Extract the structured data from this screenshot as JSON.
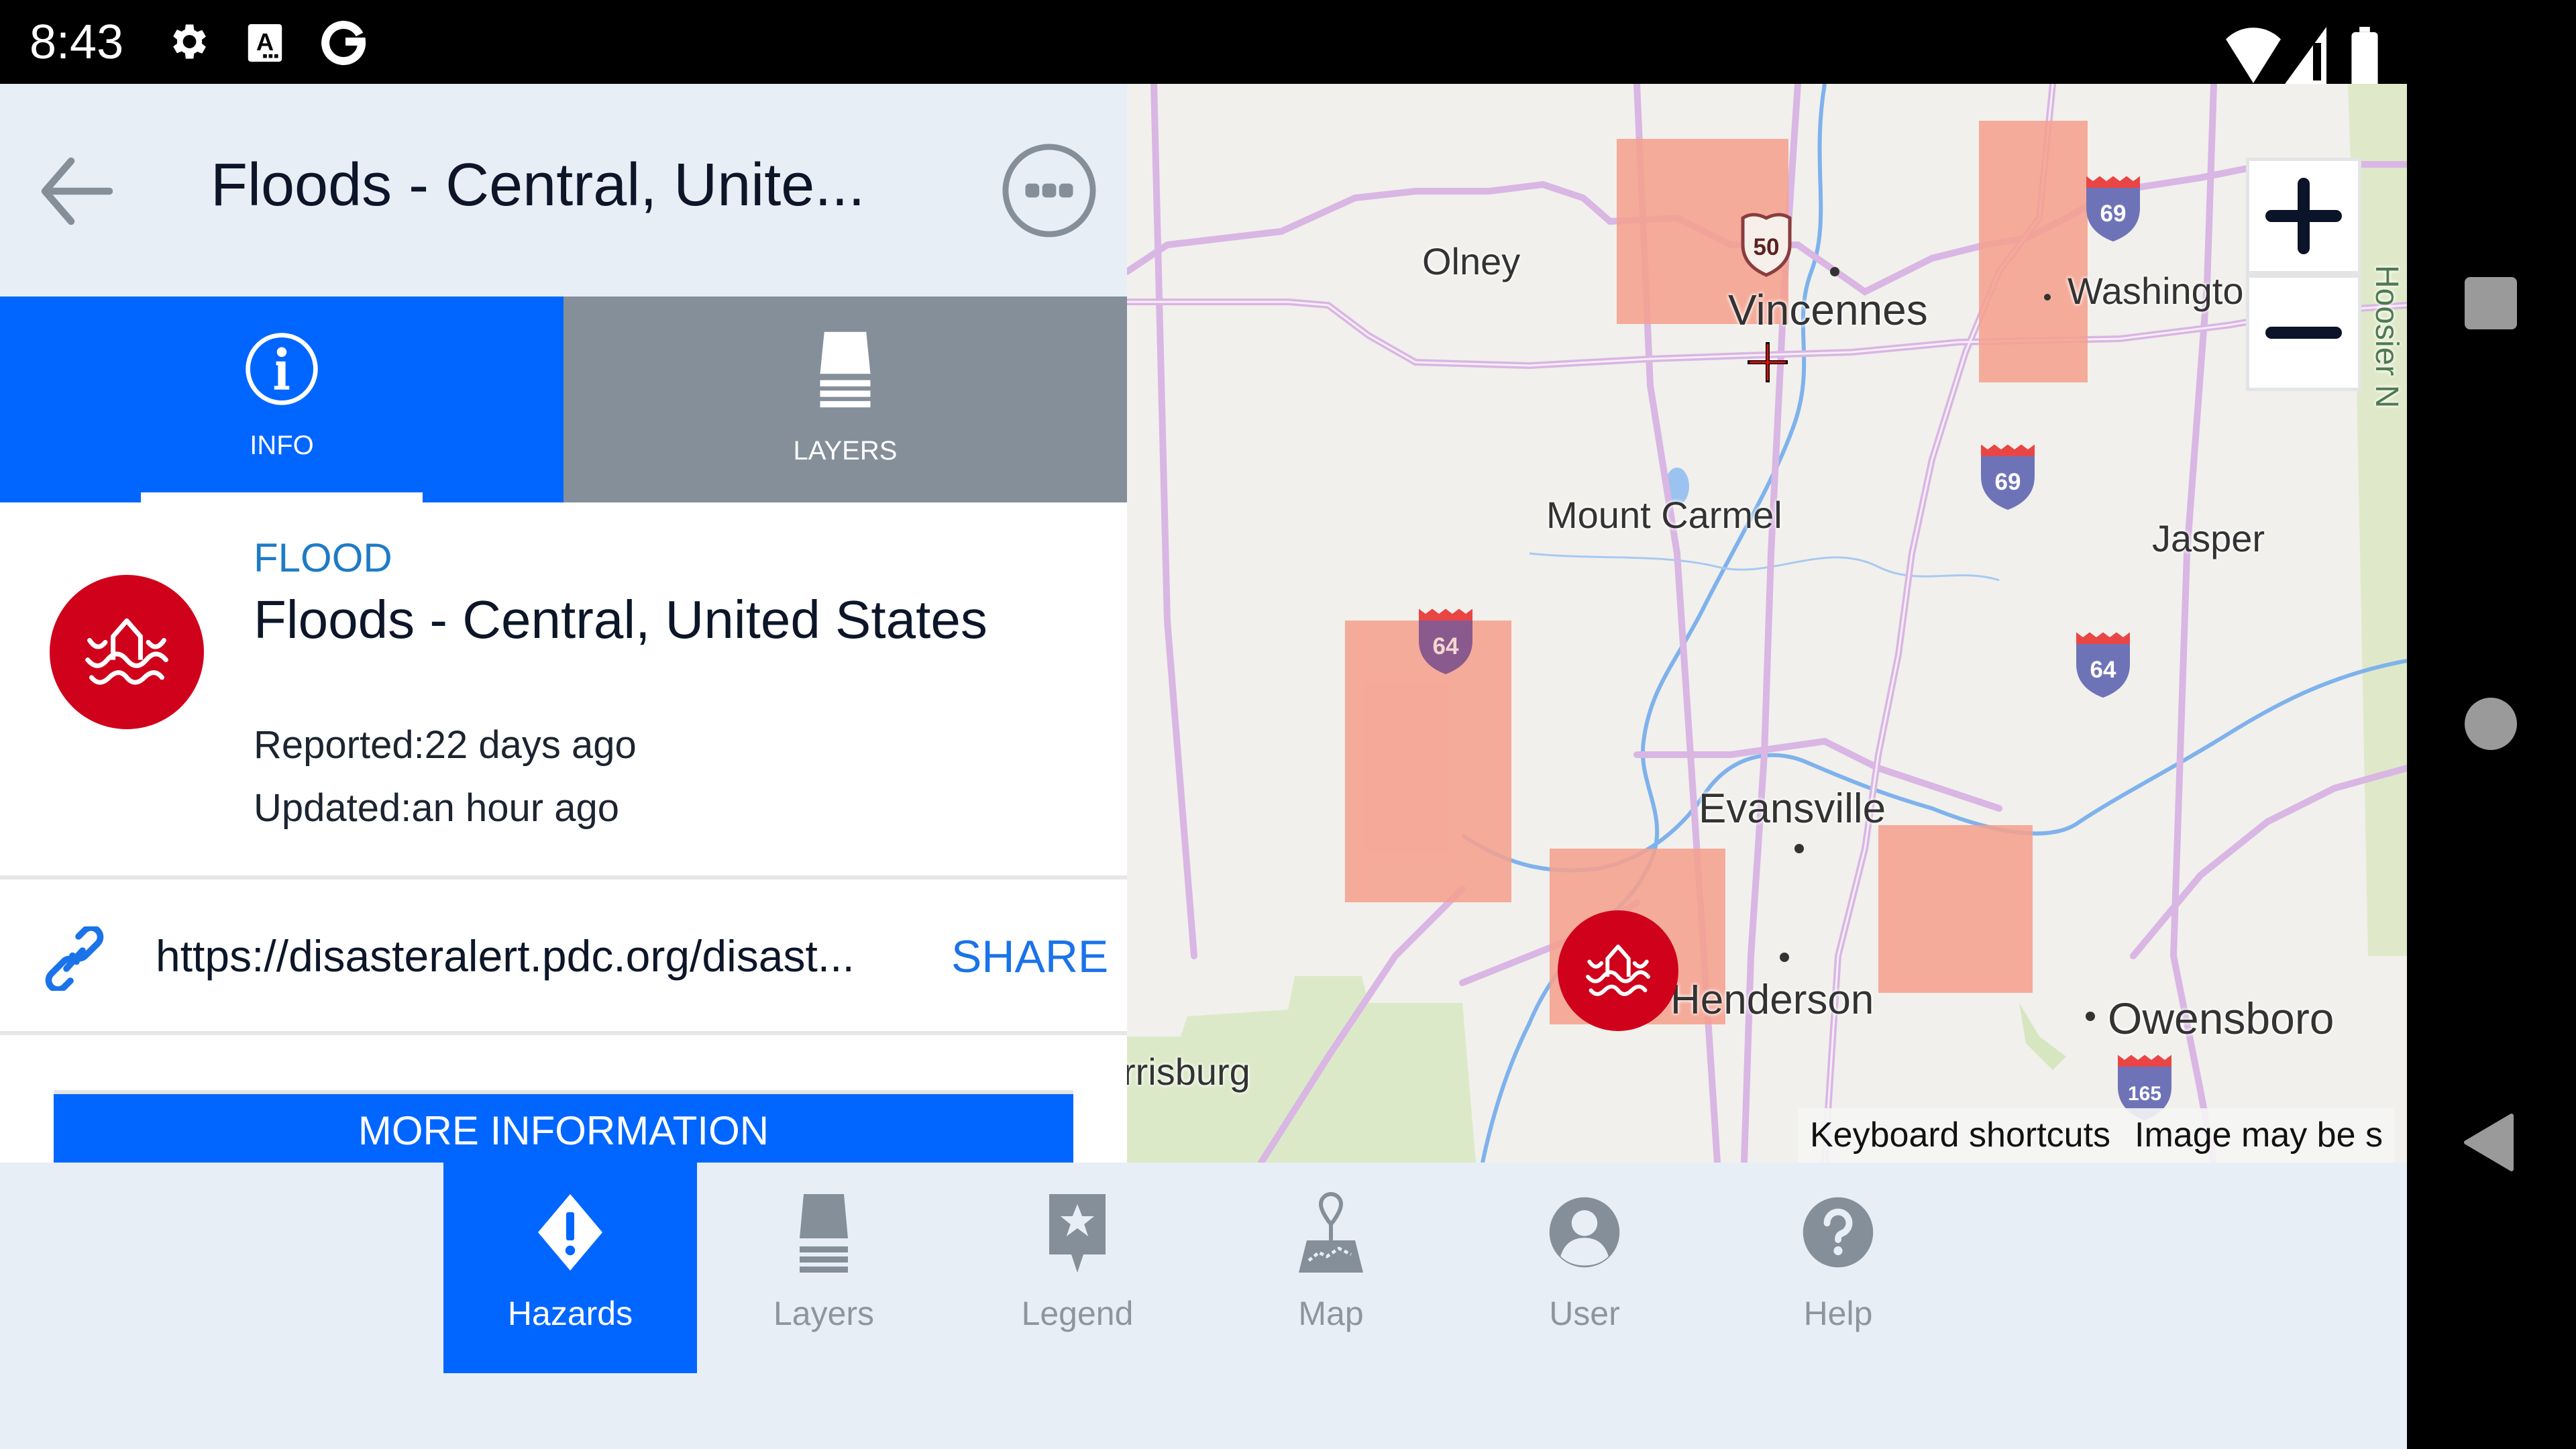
{
  "status_bar": {
    "time": "8:43",
    "left_icons": [
      "gear-icon",
      "font-a-icon",
      "google-g-icon"
    ],
    "right_icons": [
      "wifi-icon",
      "cell-signal-icon",
      "battery-icon"
    ]
  },
  "header": {
    "title": "Floods - Central, Unite...",
    "back_icon": "arrow-left-icon",
    "more_icon": "more-horizontal-circle-icon"
  },
  "tabs": [
    {
      "label": "INFO",
      "icon": "info-circle-icon",
      "active": true
    },
    {
      "label": "LAYERS",
      "icon": "layers-icon",
      "active": false
    }
  ],
  "hazard": {
    "type": "FLOOD",
    "title": "Floods - Central, United States",
    "reported": "Reported:22 days ago",
    "updated": "Updated:an hour ago",
    "icon": "flood-icon",
    "color": "#d0021b"
  },
  "link": {
    "url": "https://disasteralert.pdc.org/disast...",
    "share_label": "SHARE"
  },
  "more_info_label": "MORE INFORMATION",
  "map": {
    "labels": {
      "olney": "Olney",
      "vincennes": "Vincennes",
      "washington": "Washingto",
      "mount_carmel": "Mount Carmel",
      "jasper": "Jasper",
      "evansville": "Evansville",
      "henderson": "Henderson",
      "owensboro": "Owensboro",
      "harrisburg": "rrisburg",
      "hoosier": "Hoosier N"
    },
    "shields": {
      "us50": "50",
      "i69_north": "69",
      "i69_south": "69",
      "i64_west": "64",
      "i64_east": "64",
      "i165": "165"
    },
    "zoom_in_label": "+",
    "zoom_out_label": "−",
    "attribution": {
      "keyboard_shortcuts": "Keyboard shortcuts",
      "image_notice": "Image may be s"
    },
    "flood_area_color": "#f5a18e"
  },
  "bottom_nav": [
    {
      "label": "Hazards",
      "icon": "hazard-diamond-icon",
      "active": true
    },
    {
      "label": "Layers",
      "icon": "layers-icon",
      "active": false
    },
    {
      "label": "Legend",
      "icon": "legend-star-icon",
      "active": false
    },
    {
      "label": "Map",
      "icon": "map-pin-icon",
      "active": false
    },
    {
      "label": "User",
      "icon": "user-icon",
      "active": false
    },
    {
      "label": "Help",
      "icon": "help-icon",
      "active": false
    }
  ],
  "colors": {
    "accent": "#0066ff",
    "tab_inactive": "#848f99",
    "hazard_red": "#d0021b",
    "hazard_type_blue": "#1f7bc4",
    "header_bg": "#e8eef6"
  }
}
